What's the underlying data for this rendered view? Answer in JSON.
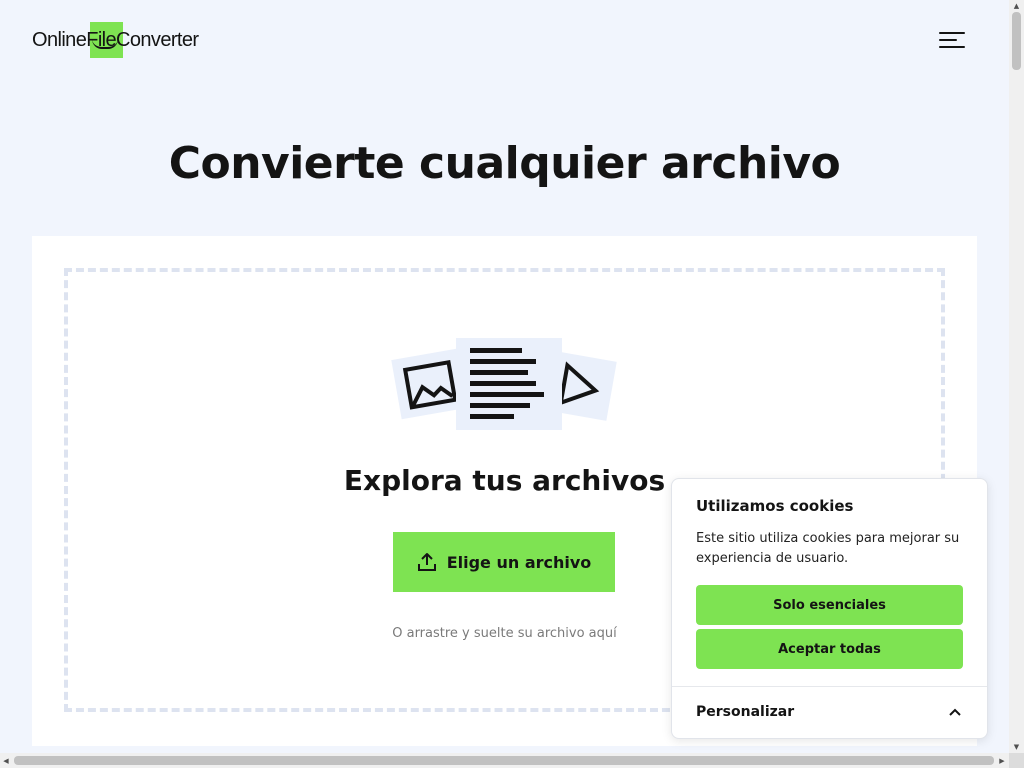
{
  "header": {
    "logo_text": "OnlineFileConverter",
    "menu_icon": "hamburger-menu-icon"
  },
  "main": {
    "title": "Convierte cualquier archivo",
    "dropzone": {
      "illustration_icons": [
        "image-file-icon",
        "document-file-icon",
        "video-file-icon"
      ],
      "heading": "Explora tus archivos",
      "choose_button_label": "Elige un archivo",
      "choose_button_icon": "upload-icon",
      "drag_hint": "O arrastre y suelte su archivo aquí"
    }
  },
  "cookie_banner": {
    "title": "Utilizamos cookies",
    "text": "Este sitio utiliza cookies para mejorar su experiencia de usuario.",
    "essential_button": "Solo esenciales",
    "accept_button": "Aceptar todas",
    "customize_label": "Personalizar",
    "customize_icon": "chevron-up-icon"
  },
  "colors": {
    "accent": "#7ee352",
    "background": "#f1f5fd",
    "text": "#141414"
  }
}
